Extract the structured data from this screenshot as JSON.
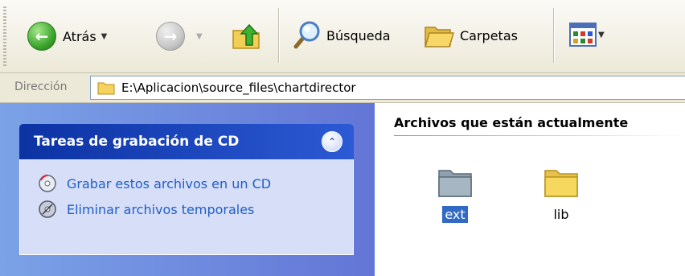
{
  "toolbar": {
    "back_label": "Atrás",
    "search_label": "Búsqueda",
    "folders_label": "Carpetas"
  },
  "address_bar": {
    "label": "Dirección",
    "path": "E:\\Aplicacion\\source_files\\chartdirector"
  },
  "task_pane": {
    "title": "Tareas de grabación de CD",
    "items": [
      {
        "label": "Grabar estos archivos en un CD",
        "icon": "cd-burn-icon"
      },
      {
        "label": "Eliminar archivos temporales",
        "icon": "delete-temp-files-icon"
      }
    ]
  },
  "content": {
    "group_header": "Archivos que están actualmente",
    "folders": [
      {
        "name": "ext",
        "selected": true
      },
      {
        "name": "lib",
        "selected": false
      }
    ]
  },
  "colors": {
    "selection": "#316ac5",
    "task_link": "#215dc6",
    "task_header": "#0c32a3",
    "folder_yellow": "#f7d85e"
  }
}
